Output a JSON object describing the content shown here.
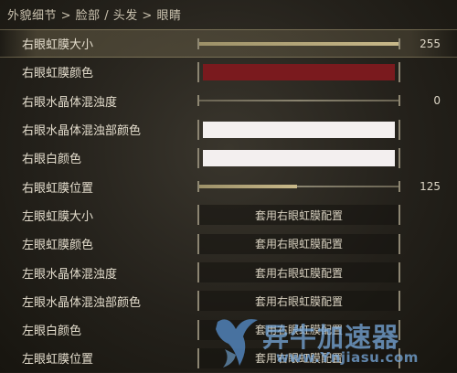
{
  "breadcrumb": "外貌细节 > 脸部 / 头发 > 眼睛",
  "rows": [
    {
      "label": "右眼虹膜大小",
      "type": "slider",
      "value": "255",
      "fraction": 1.0,
      "highlight": true
    },
    {
      "label": "右眼虹膜颜色",
      "type": "color",
      "color": "#7a1a1e"
    },
    {
      "label": "右眼水晶体混浊度",
      "type": "slider",
      "value": "0",
      "fraction": 0.0
    },
    {
      "label": "右眼水晶体混浊部颜色",
      "type": "color",
      "color": "#f4f0ef"
    },
    {
      "label": "右眼白颜色",
      "type": "color",
      "color": "#f3efef"
    },
    {
      "label": "右眼虹膜位置",
      "type": "slider",
      "value": "125",
      "fraction": 0.49
    },
    {
      "label": "左眼虹膜大小",
      "type": "button",
      "button": "套用右眼虹膜配置"
    },
    {
      "label": "左眼虹膜颜色",
      "type": "button",
      "button": "套用右眼虹膜配置"
    },
    {
      "label": "左眼水晶体混浊度",
      "type": "button",
      "button": "套用右眼虹膜配置"
    },
    {
      "label": "左眼水晶体混浊部颜色",
      "type": "button",
      "button": "套用右眼虹膜配置"
    },
    {
      "label": "左眼白颜色",
      "type": "button",
      "button": "套用右眼虹膜配置"
    },
    {
      "label": "左眼虹膜位置",
      "type": "button",
      "button": "套用右眼虹膜配置"
    }
  ],
  "watermark": {
    "name": "异牛加速器",
    "url": "www.Ynjiasu.com"
  }
}
